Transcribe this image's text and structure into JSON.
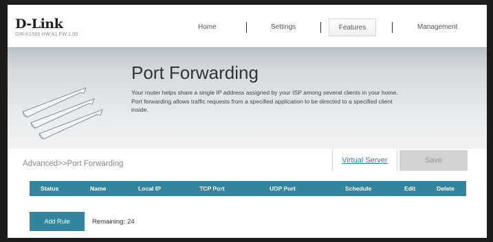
{
  "brand": {
    "logo": "D-Link",
    "subtitle": "DIR-X1560 HW:A1 FW:1.00"
  },
  "nav": {
    "items": [
      {
        "label": "Home"
      },
      {
        "label": "Settings"
      },
      {
        "label": "Features",
        "active": true
      },
      {
        "label": "Management"
      }
    ]
  },
  "banner": {
    "title": "Port Forwarding",
    "description_line1": "Your router helps share a single IP address assigned by your ISP among several clients in your home.",
    "description_line2": "Port forwarding allows traffic requests from a specified application to be directed to a specified client",
    "description_line3": "inside.",
    "icon": "port-forwarding-arrows-icon"
  },
  "breadcrumb": "Advanced>>Port Forwarding",
  "actions": {
    "virtual_server": "Virtual Server",
    "save": "Save"
  },
  "table": {
    "columns": [
      "Status",
      "Name",
      "Local IP",
      "TCP Port",
      "UDP Port",
      "Schedule",
      "Edit",
      "Delete"
    ]
  },
  "rules": {
    "add_label": "Add Rule",
    "remaining_label": "Remaining:",
    "remaining_count": "24"
  },
  "colors": {
    "accent": "#34859e",
    "link": "#2a84a0",
    "save_disabled": "#d2d2d2"
  }
}
